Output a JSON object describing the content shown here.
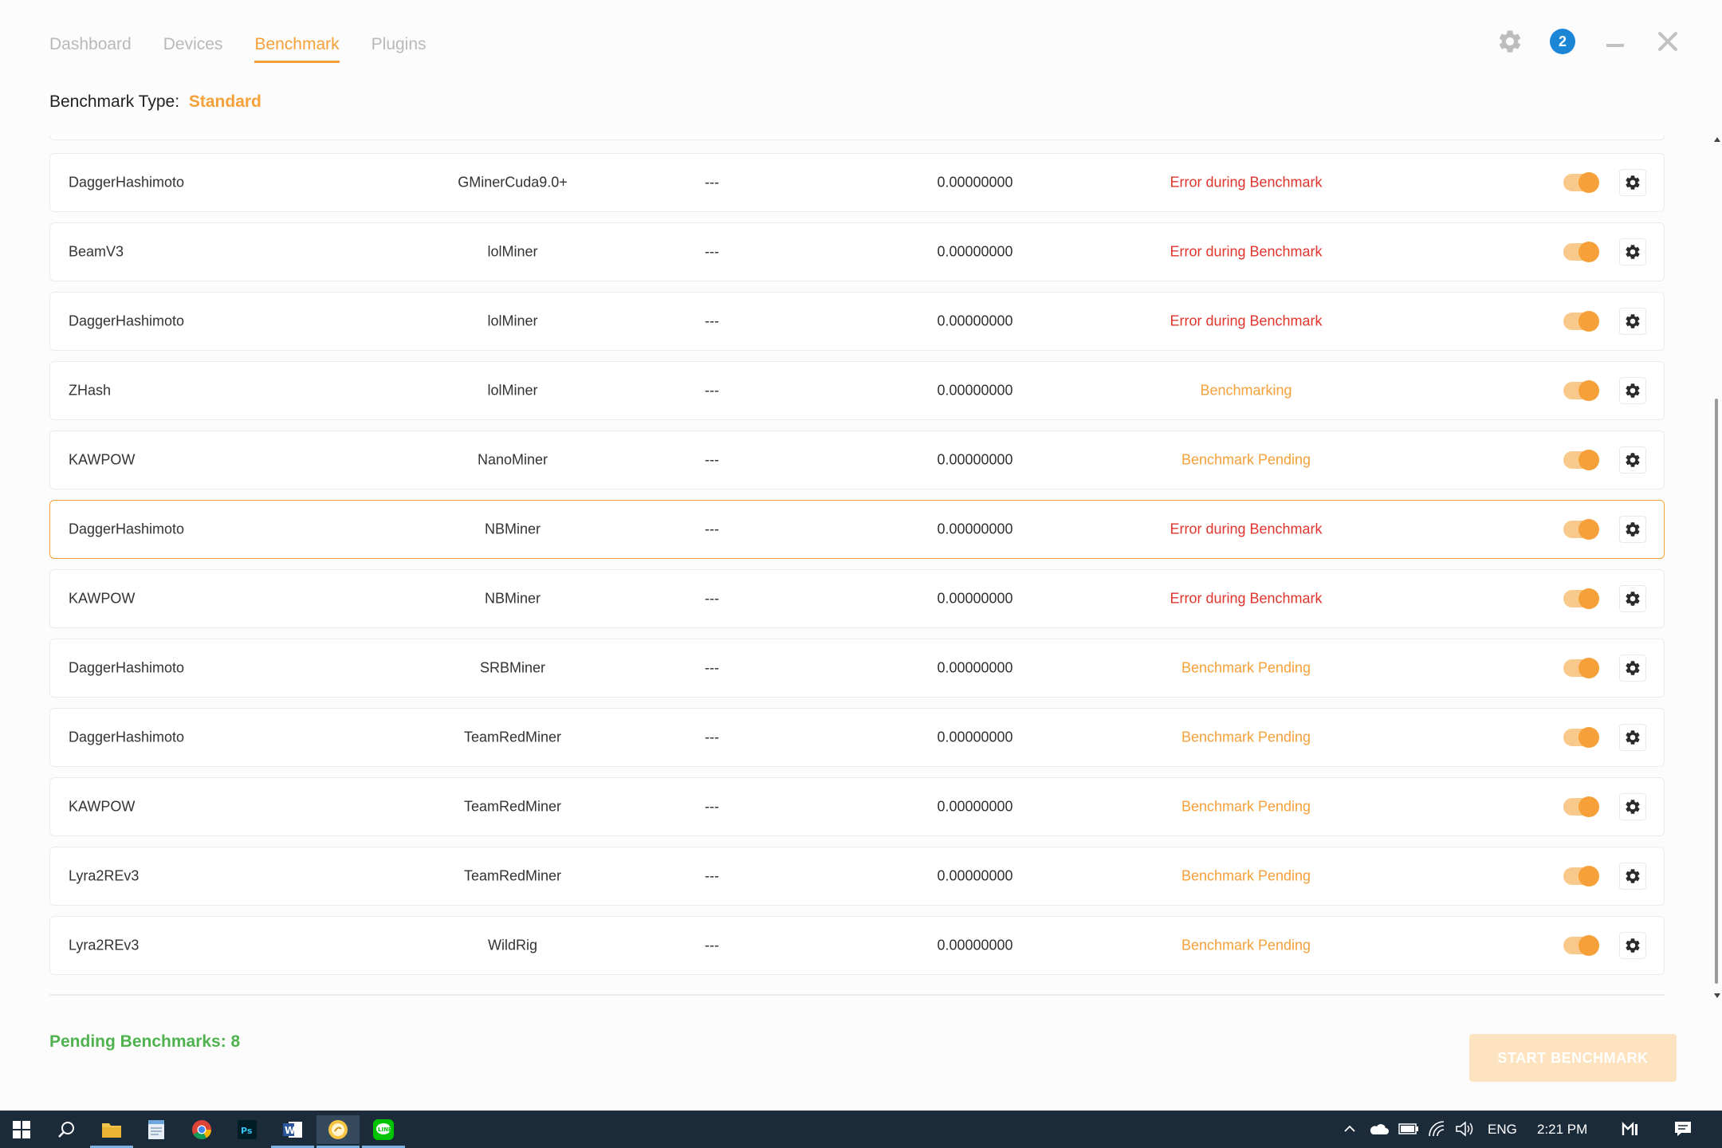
{
  "nav": {
    "tabs": [
      {
        "label": "Dashboard",
        "active": false
      },
      {
        "label": "Devices",
        "active": false
      },
      {
        "label": "Benchmark",
        "active": true
      },
      {
        "label": "Plugins",
        "active": false
      }
    ]
  },
  "header": {
    "notification_count": "2"
  },
  "benchmark_type": {
    "label": "Benchmark Type:",
    "value": "Standard"
  },
  "rows": [
    {
      "algorithm": "DaggerHashimoto",
      "miner": "GMinerCuda9.0+",
      "speed": "---",
      "profit": "0.00000000",
      "status": "Error during Benchmark",
      "status_kind": "error",
      "enabled": true
    },
    {
      "algorithm": "BeamV3",
      "miner": "lolMiner",
      "speed": "---",
      "profit": "0.00000000",
      "status": "Error during Benchmark",
      "status_kind": "error",
      "enabled": true
    },
    {
      "algorithm": "DaggerHashimoto",
      "miner": "lolMiner",
      "speed": "---",
      "profit": "0.00000000",
      "status": "Error during Benchmark",
      "status_kind": "error",
      "enabled": true
    },
    {
      "algorithm": "ZHash",
      "miner": "lolMiner",
      "speed": "---",
      "profit": "0.00000000",
      "status": "Benchmarking",
      "status_kind": "warn",
      "enabled": true
    },
    {
      "algorithm": "KAWPOW",
      "miner": "NanoMiner",
      "speed": "---",
      "profit": "0.00000000",
      "status": "Benchmark Pending",
      "status_kind": "warn",
      "enabled": true
    },
    {
      "algorithm": "DaggerHashimoto",
      "miner": "NBMiner",
      "speed": "---",
      "profit": "0.00000000",
      "status": "Error during Benchmark",
      "status_kind": "error",
      "enabled": true,
      "selected": true
    },
    {
      "algorithm": "KAWPOW",
      "miner": "NBMiner",
      "speed": "---",
      "profit": "0.00000000",
      "status": "Error during Benchmark",
      "status_kind": "error",
      "enabled": true
    },
    {
      "algorithm": "DaggerHashimoto",
      "miner": "SRBMiner",
      "speed": "---",
      "profit": "0.00000000",
      "status": "Benchmark Pending",
      "status_kind": "warn",
      "enabled": true
    },
    {
      "algorithm": "DaggerHashimoto",
      "miner": "TeamRedMiner",
      "speed": "---",
      "profit": "0.00000000",
      "status": "Benchmark Pending",
      "status_kind": "warn",
      "enabled": true
    },
    {
      "algorithm": "KAWPOW",
      "miner": "TeamRedMiner",
      "speed": "---",
      "profit": "0.00000000",
      "status": "Benchmark Pending",
      "status_kind": "warn",
      "enabled": true
    },
    {
      "algorithm": "Lyra2REv3",
      "miner": "TeamRedMiner",
      "speed": "---",
      "profit": "0.00000000",
      "status": "Benchmark Pending",
      "status_kind": "warn",
      "enabled": true
    },
    {
      "algorithm": "Lyra2REv3",
      "miner": "WildRig",
      "speed": "---",
      "profit": "0.00000000",
      "status": "Benchmark Pending",
      "status_kind": "warn",
      "enabled": true
    }
  ],
  "footer": {
    "pending_label": "Pending Benchmarks: 8",
    "start_button": "START BENCHMARK"
  },
  "colors": {
    "accent": "#f5a038",
    "error": "#e0342c",
    "success": "#4fb24f",
    "badge": "#1b86d6"
  },
  "taskbar": {
    "apps": [
      "start-icon",
      "search-icon",
      "file-explorer-icon",
      "notepad-icon",
      "chrome-icon",
      "photoshop-icon",
      "word-icon",
      "nicehash-icon",
      "line-icon"
    ],
    "language": "ENG",
    "time": "2:21 PM"
  }
}
